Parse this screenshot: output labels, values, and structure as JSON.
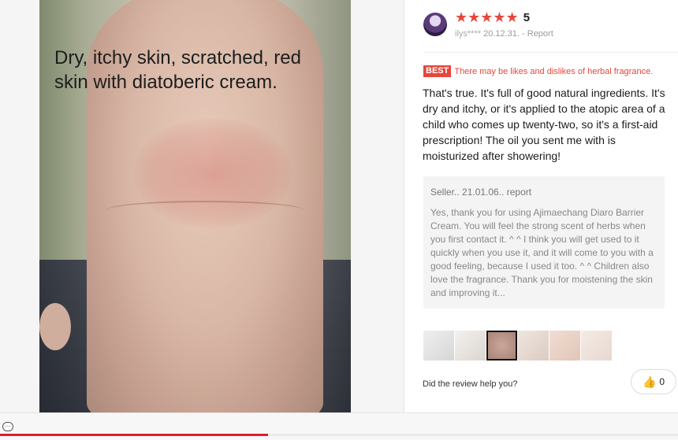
{
  "photo": {
    "caption": "Dry, itchy skin, scratched, red skin with diatoberic cream."
  },
  "review": {
    "rating": 5,
    "stars": "★★★★★",
    "rating_label": "5",
    "user": "ilys****",
    "date": "20.12.31.",
    "report_label": "Report",
    "best_badge": "BEST",
    "best_title": "There may be likes and dislikes of herbal fragrance.",
    "body": "That's true. It's full of good natural ingredients. It's dry and itchy, or it's applied to the atopic area of a child who comes up twenty-two, so it's a first-aid prescription! The oil you sent me with is moisturized after showering!"
  },
  "seller_reply": {
    "header": "Seller.. 21.01.06.. report",
    "body": "Yes, thank you for using Ajimaechang Diaro Barrier Cream. You will feel the strong scent of herbs when you first contact it. ^ ^ I think you will get used to it quickly when you use it, and it will come to you with a good feeling, because I used it too. ^ ^ Children also love the fragrance. Thank you for moistening the skin and improving it..."
  },
  "thumbnails": {
    "count": 6,
    "selected_index": 2
  },
  "helpful": {
    "question": "Did the review help you?",
    "like_icon": "thumbs-up-icon",
    "like_count": "0"
  },
  "bottom_bar": {
    "chat_icon": "chat-bubble-icon",
    "progress": 0.395,
    "progress_color": "#e01e2e"
  },
  "colors": {
    "accent": "#e8453c"
  }
}
